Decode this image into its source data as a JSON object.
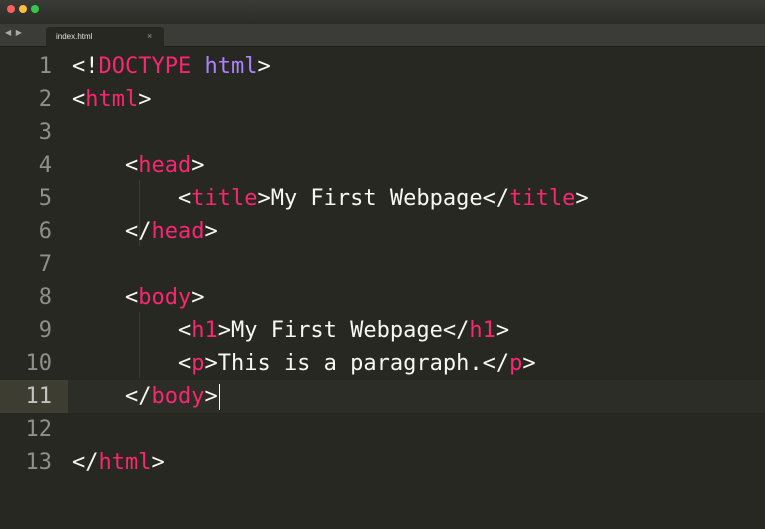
{
  "window": {
    "traffic_lights": [
      "close-button",
      "minimize-button",
      "zoom-button"
    ],
    "colors": {
      "close": "#fc605c",
      "minimize": "#fdbc40",
      "zoom": "#34c84a"
    }
  },
  "tabbar": {
    "nav_arrows": "◀ ▶",
    "tabs": [
      {
        "title": "index.html",
        "close": "×"
      }
    ]
  },
  "editor": {
    "current_line": 11,
    "theme_colors": {
      "background": "#272822",
      "text": "#f8f8f2",
      "tag": "#f92672",
      "keyword": "#ae81ff",
      "gutter": "#8f908a"
    },
    "lines": [
      {
        "n": "1",
        "tokens": [
          {
            "t": "<!",
            "c": "plain"
          },
          {
            "t": "DOCTYPE",
            "c": "tag"
          },
          {
            "t": " ",
            "c": "plain"
          },
          {
            "t": "html",
            "c": "attr"
          },
          {
            "t": ">",
            "c": "plain"
          }
        ]
      },
      {
        "n": "2",
        "tokens": [
          {
            "t": "<",
            "c": "plain"
          },
          {
            "t": "html",
            "c": "tag"
          },
          {
            "t": ">",
            "c": "plain"
          }
        ]
      },
      {
        "n": "3",
        "tokens": []
      },
      {
        "n": "4",
        "tokens": [
          {
            "t": "    <",
            "c": "plain"
          },
          {
            "t": "head",
            "c": "tag"
          },
          {
            "t": ">",
            "c": "plain"
          }
        ]
      },
      {
        "n": "5",
        "tokens": [
          {
            "t": "        <",
            "c": "plain"
          },
          {
            "t": "title",
            "c": "tag"
          },
          {
            "t": ">My First Webpage</",
            "c": "plain"
          },
          {
            "t": "title",
            "c": "tag"
          },
          {
            "t": ">",
            "c": "plain"
          }
        ]
      },
      {
        "n": "6",
        "tokens": [
          {
            "t": "    </",
            "c": "plain"
          },
          {
            "t": "head",
            "c": "tag"
          },
          {
            "t": ">",
            "c": "plain"
          }
        ]
      },
      {
        "n": "7",
        "tokens": []
      },
      {
        "n": "8",
        "tokens": [
          {
            "t": "    <",
            "c": "plain"
          },
          {
            "t": "body",
            "c": "tag"
          },
          {
            "t": ">",
            "c": "plain"
          }
        ]
      },
      {
        "n": "9",
        "tokens": [
          {
            "t": "        <",
            "c": "plain"
          },
          {
            "t": "h1",
            "c": "tag"
          },
          {
            "t": ">My First Webpage</",
            "c": "plain"
          },
          {
            "t": "h1",
            "c": "tag"
          },
          {
            "t": ">",
            "c": "plain"
          }
        ]
      },
      {
        "n": "10",
        "tokens": [
          {
            "t": "        <",
            "c": "plain"
          },
          {
            "t": "p",
            "c": "tag"
          },
          {
            "t": ">This is a paragraph.</",
            "c": "plain"
          },
          {
            "t": "p",
            "c": "tag"
          },
          {
            "t": ">",
            "c": "plain"
          }
        ]
      },
      {
        "n": "11",
        "tokens": [
          {
            "t": "    </",
            "c": "plain"
          },
          {
            "t": "body",
            "c": "tag"
          },
          {
            "t": ">",
            "c": "plain"
          }
        ]
      },
      {
        "n": "12",
        "tokens": []
      },
      {
        "n": "13",
        "tokens": [
          {
            "t": "</",
            "c": "plain"
          },
          {
            "t": "html",
            "c": "tag"
          },
          {
            "t": ">",
            "c": "plain"
          }
        ]
      }
    ]
  }
}
